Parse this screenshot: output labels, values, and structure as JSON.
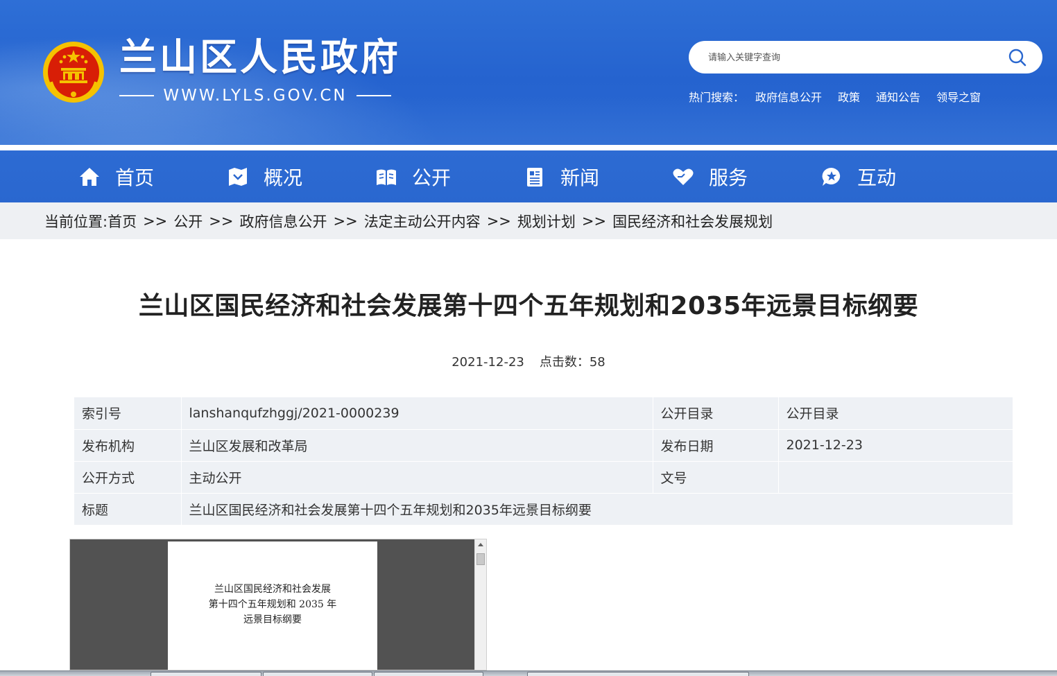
{
  "header": {
    "site_title": "兰山区人民政府",
    "site_url": "WWW.LYLS.GOV.CN",
    "search": {
      "placeholder": "请输入关键字查询"
    },
    "hot_search": {
      "label": "热门搜索：",
      "links": [
        "政府信息公开",
        "政策",
        "通知公告",
        "领导之窗"
      ]
    }
  },
  "nav": {
    "items": [
      {
        "label": "首页",
        "icon": "home-icon"
      },
      {
        "label": "概况",
        "icon": "overview-icon"
      },
      {
        "label": "公开",
        "icon": "book-icon"
      },
      {
        "label": "新闻",
        "icon": "news-icon"
      },
      {
        "label": "服务",
        "icon": "heart-hand-icon"
      },
      {
        "label": "互动",
        "icon": "chat-star-icon"
      }
    ]
  },
  "breadcrumb": {
    "prefix": "当前位置: ",
    "separator": ">>",
    "items": [
      "首页",
      "公开",
      "政府信息公开",
      "法定主动公开内容",
      "规划计划",
      "国民经济和社会发展规划"
    ]
  },
  "article": {
    "title": "兰山区国民经济和社会发展第十四个五年规划和2035年远景目标纲要",
    "date": "2021-12-23",
    "clicks_label": "点击数：",
    "clicks": "58"
  },
  "info_table": {
    "rows": [
      {
        "k1": "索引号",
        "v1": "lanshanqufzhggj/2021-0000239",
        "k2": "公开目录",
        "v2": "公开目录"
      },
      {
        "k1": "发布机构",
        "v1": "兰山区发展和改革局",
        "k2": "发布日期",
        "v2": "2021-12-23"
      },
      {
        "k1": "公开方式",
        "v1": "主动公开",
        "k2": "文号",
        "v2": ""
      },
      {
        "k1": "标题",
        "v1": "兰山区国民经济和社会发展第十四个五年规划和2035年远景目标纲要"
      }
    ]
  },
  "pdf": {
    "lines": [
      "兰山区国民经济和社会发展",
      "第十四个五年规划和 2035 年",
      "远景目标纲要"
    ]
  },
  "colors": {
    "header_blue": "#2563cf",
    "nav_blue": "#2a67cf",
    "breadcrumb_bg": "#eef0f3",
    "table_bg": "#eef1f5",
    "emblem_red": "#d81e06",
    "emblem_gold": "#f5c200"
  }
}
